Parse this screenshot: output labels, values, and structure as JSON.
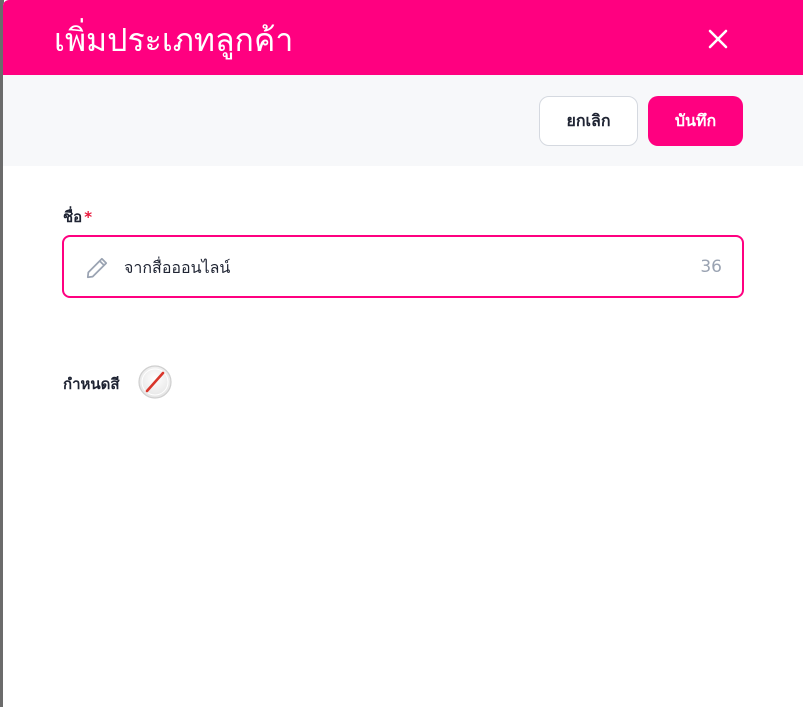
{
  "modal": {
    "title": "เพิ่มประเภทลูกค้า"
  },
  "toolbar": {
    "cancel_label": "ยกเลิก",
    "save_label": "บันทึก"
  },
  "form": {
    "name_label": "ชื่อ",
    "required_mark": "*",
    "name_value": "จากสื่อออนไลน์",
    "char_count": "36",
    "color_label": "กำหนดสี"
  },
  "colors": {
    "accent": "#ff0080",
    "required": "#e8173b",
    "toolbar_bg": "#f7f8fa",
    "muted_text": "#9aa3b2"
  },
  "icons": {
    "close": "close-icon",
    "edit": "pencil-icon",
    "color": "no-color-swatch-icon"
  }
}
